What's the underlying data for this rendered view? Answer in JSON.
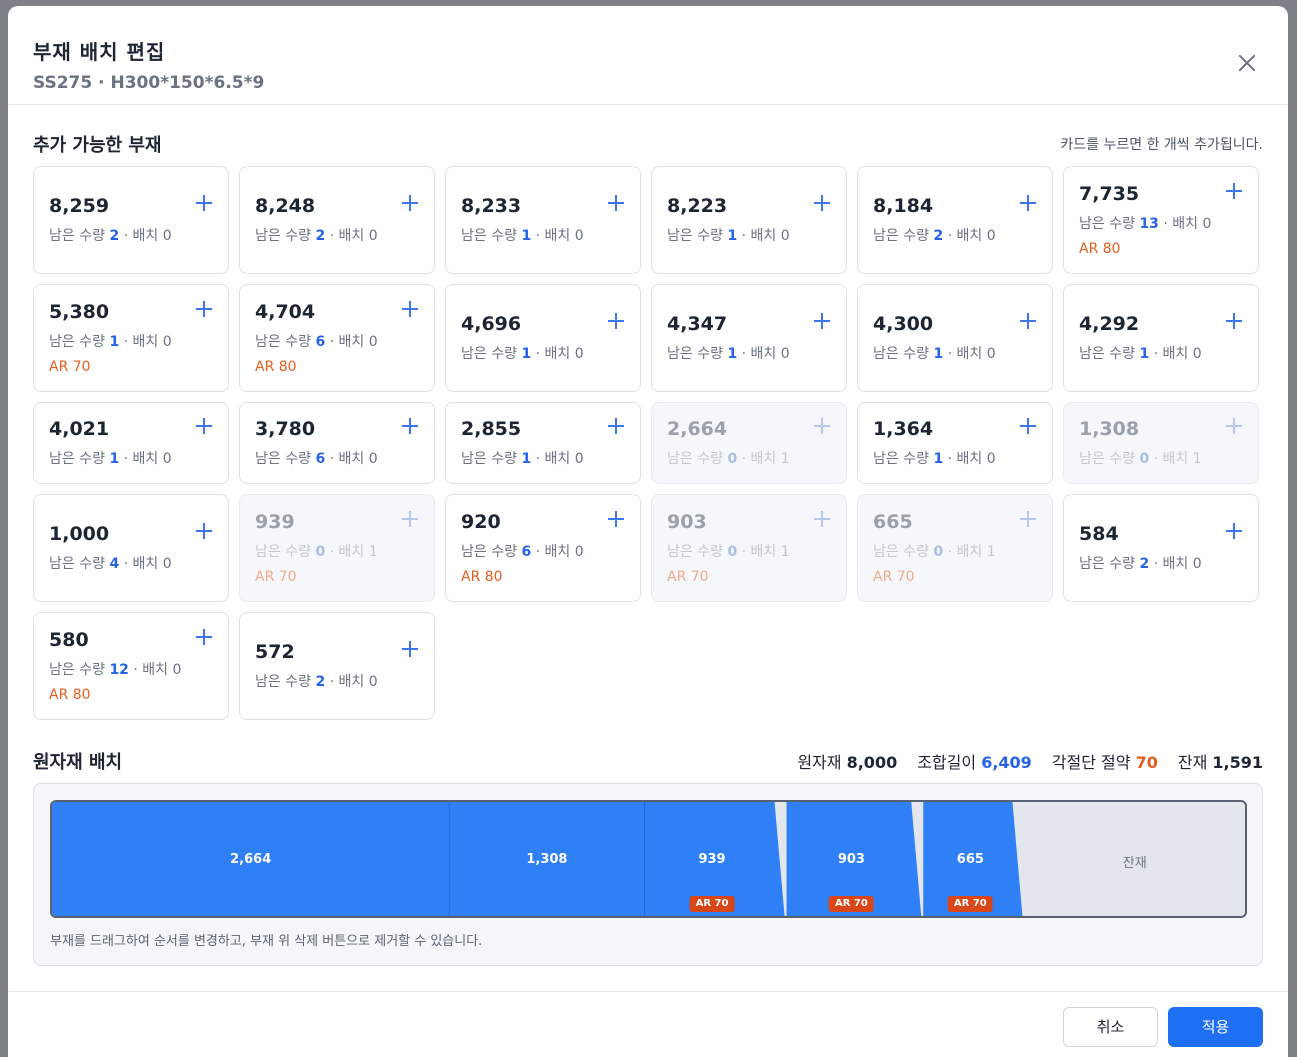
{
  "modal": {
    "title": "부재 배치 편집",
    "subtitle": "SS275 · H300*150*6.5*9"
  },
  "available": {
    "title": "추가 가능한 부재",
    "hint": "카드를 누르면 한 개씩 추가됩니다.",
    "remaining_label": "남은 수량",
    "placed_label": "배치",
    "cards": [
      {
        "length": "8,259",
        "remaining": "2",
        "placed": "0",
        "ar": "",
        "disabled": false
      },
      {
        "length": "8,248",
        "remaining": "2",
        "placed": "0",
        "ar": "",
        "disabled": false
      },
      {
        "length": "8,233",
        "remaining": "1",
        "placed": "0",
        "ar": "",
        "disabled": false
      },
      {
        "length": "8,223",
        "remaining": "1",
        "placed": "0",
        "ar": "",
        "disabled": false
      },
      {
        "length": "8,184",
        "remaining": "2",
        "placed": "0",
        "ar": "",
        "disabled": false
      },
      {
        "length": "7,735",
        "remaining": "13",
        "placed": "0",
        "ar": "AR 80",
        "disabled": false
      },
      {
        "length": "5,380",
        "remaining": "1",
        "placed": "0",
        "ar": "AR 70",
        "disabled": false
      },
      {
        "length": "4,704",
        "remaining": "6",
        "placed": "0",
        "ar": "AR 80",
        "disabled": false
      },
      {
        "length": "4,696",
        "remaining": "1",
        "placed": "0",
        "ar": "",
        "disabled": false
      },
      {
        "length": "4,347",
        "remaining": "1",
        "placed": "0",
        "ar": "",
        "disabled": false
      },
      {
        "length": "4,300",
        "remaining": "1",
        "placed": "0",
        "ar": "",
        "disabled": false
      },
      {
        "length": "4,292",
        "remaining": "1",
        "placed": "0",
        "ar": "",
        "disabled": false
      },
      {
        "length": "4,021",
        "remaining": "1",
        "placed": "0",
        "ar": "",
        "disabled": false
      },
      {
        "length": "3,780",
        "remaining": "6",
        "placed": "0",
        "ar": "",
        "disabled": false
      },
      {
        "length": "2,855",
        "remaining": "1",
        "placed": "0",
        "ar": "",
        "disabled": false
      },
      {
        "length": "2,664",
        "remaining": "0",
        "placed": "1",
        "ar": "",
        "disabled": true
      },
      {
        "length": "1,364",
        "remaining": "1",
        "placed": "0",
        "ar": "",
        "disabled": false
      },
      {
        "length": "1,308",
        "remaining": "0",
        "placed": "1",
        "ar": "",
        "disabled": true
      },
      {
        "length": "1,000",
        "remaining": "4",
        "placed": "0",
        "ar": "",
        "disabled": false
      },
      {
        "length": "939",
        "remaining": "0",
        "placed": "1",
        "ar": "AR 70",
        "disabled": true
      },
      {
        "length": "920",
        "remaining": "6",
        "placed": "0",
        "ar": "AR 80",
        "disabled": false
      },
      {
        "length": "903",
        "remaining": "0",
        "placed": "1",
        "ar": "AR 70",
        "disabled": true
      },
      {
        "length": "665",
        "remaining": "0",
        "placed": "1",
        "ar": "AR 70",
        "disabled": true
      },
      {
        "length": "584",
        "remaining": "2",
        "placed": "0",
        "ar": "",
        "disabled": false
      },
      {
        "length": "580",
        "remaining": "12",
        "placed": "0",
        "ar": "AR 80",
        "disabled": false
      },
      {
        "length": "572",
        "remaining": "2",
        "placed": "0",
        "ar": "",
        "disabled": false
      }
    ]
  },
  "layout": {
    "title": "원자재 배치",
    "stats": {
      "raw_label": "원자재",
      "raw_value": "8,000",
      "combined_label": "조합길이",
      "combined_value": "6,409",
      "saving_label": "각절단 절약",
      "saving_value": "70",
      "rest_label": "잔재",
      "rest_value": "1,591"
    },
    "raw_length": 8000,
    "segments": [
      {
        "label": "2,664",
        "length": 2664,
        "ar": "",
        "kerf": 0
      },
      {
        "label": "1,308",
        "length": 1308,
        "ar": "",
        "kerf": 0
      },
      {
        "label": "939",
        "length": 939,
        "ar": "AR 70",
        "kerf": 70
      },
      {
        "label": "903",
        "length": 903,
        "ar": "AR 70",
        "kerf": 70
      },
      {
        "label": "665",
        "length": 665,
        "ar": "AR 70",
        "kerf": 70
      }
    ],
    "remainder_label": "잔재",
    "hint": "부재를 드래그하여 순서를 변경하고, 부재 위 삭제 버튼으로 제거할 수 있습니다."
  },
  "colors": {
    "segment": "#2f7ff7",
    "segment_border": "#1e4fb0",
    "remainder": "#e3e7ed",
    "ar_badge": "#d9461a"
  },
  "footer": {
    "cancel_label": "취소",
    "apply_label": "적용"
  }
}
